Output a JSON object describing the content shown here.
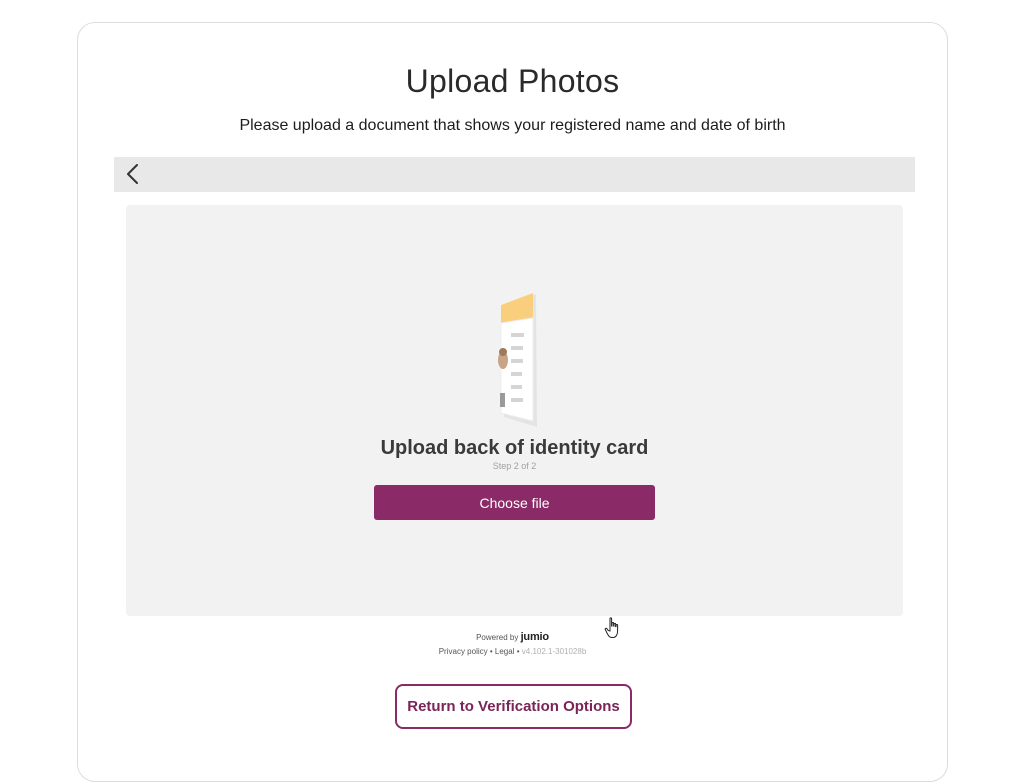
{
  "header": {
    "title": "Upload Photos",
    "subtitle": "Please upload a document that shows your registered name and date of birth"
  },
  "nav": {
    "back_icon": "chevron-left-icon"
  },
  "upload": {
    "illustration_icon": "id-card-back-icon",
    "heading": "Upload back of identity card",
    "step": "Step 2 of 2",
    "choose_file_label": "Choose file"
  },
  "footer": {
    "powered_by": "Powered by",
    "brand": "jumio",
    "privacy_link": "Privacy policy",
    "separator": "•",
    "legal_link": "Legal",
    "version": "v4.102.1-301028b"
  },
  "actions": {
    "return_label": "Return to Verification Options"
  },
  "colors": {
    "accent": "#8a2a66",
    "panel_bg": "#f2f2f2",
    "bar_bg": "#e8e8e8",
    "card_header": "#fbd37f"
  }
}
